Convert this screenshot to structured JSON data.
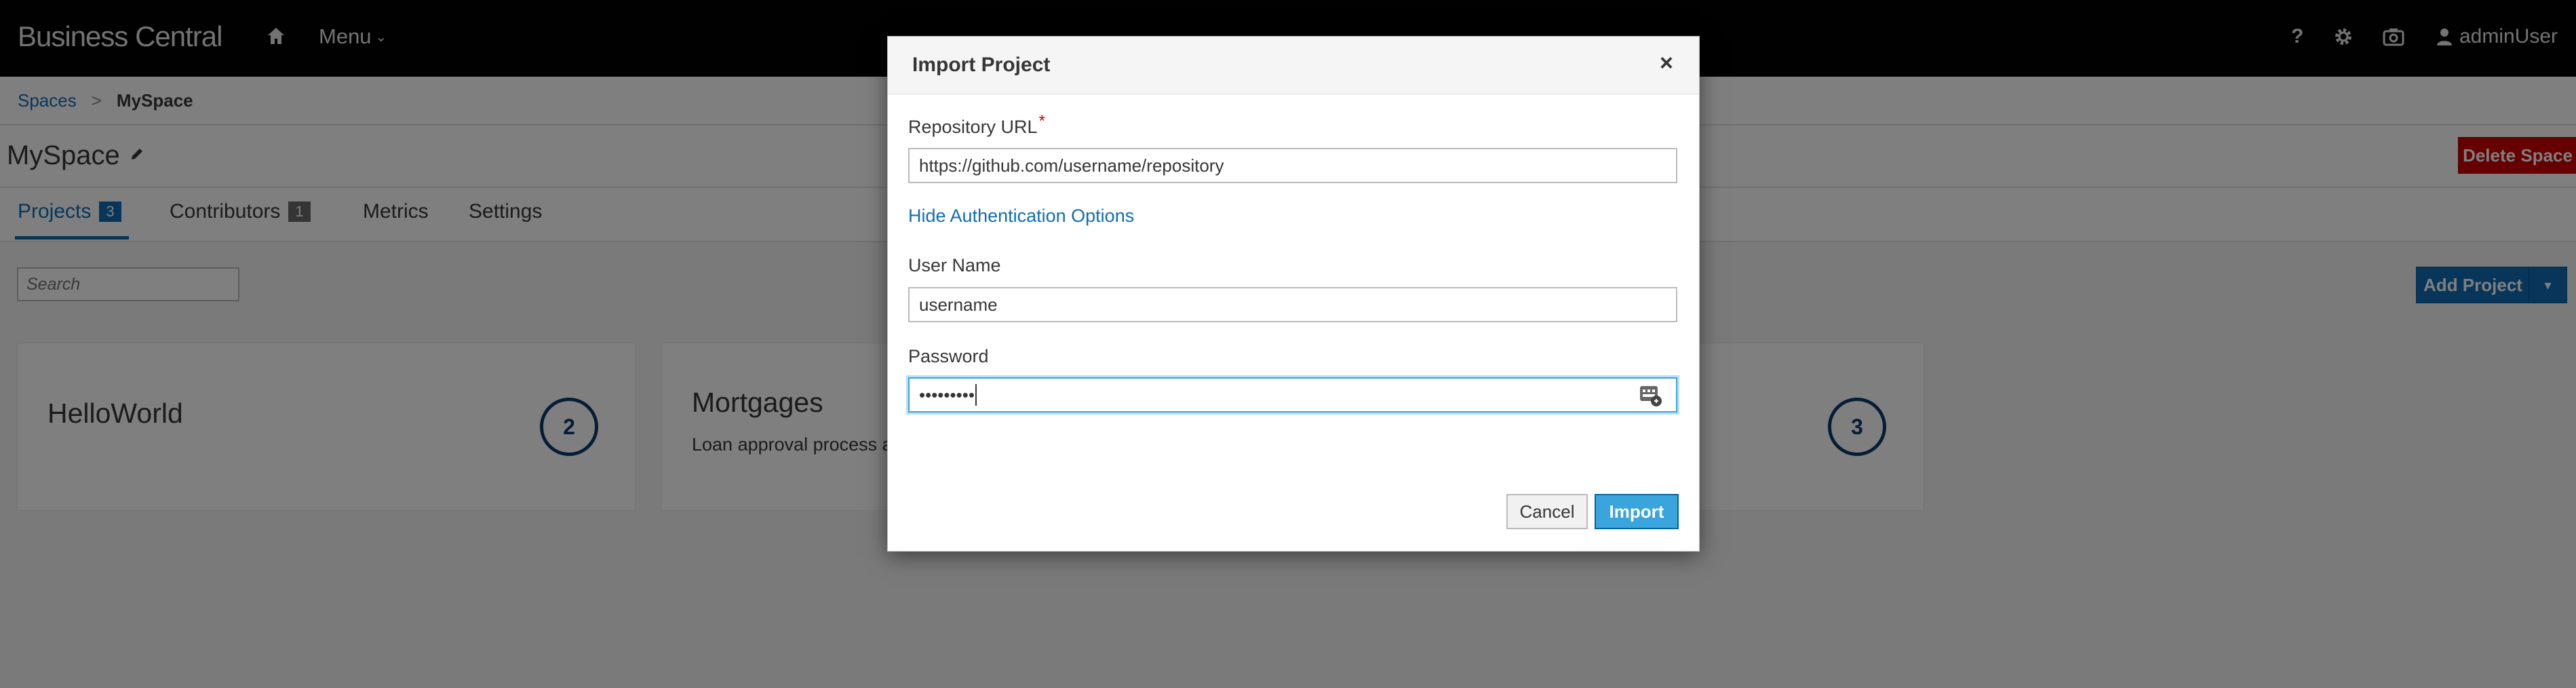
{
  "navbar": {
    "brand": "Business Central",
    "menu_label": "Menu",
    "help_label": "?",
    "user_label": "adminUser"
  },
  "breadcrumb": {
    "root": "Spaces",
    "separator": ">",
    "current": "MySpace"
  },
  "space": {
    "title": "MySpace",
    "delete_label": "Delete Space"
  },
  "tabs": [
    {
      "label": "Projects",
      "badge": "3"
    },
    {
      "label": "Contributors",
      "badge": "1"
    },
    {
      "label": "Metrics"
    },
    {
      "label": "Settings"
    }
  ],
  "toolbar": {
    "search_placeholder": "Search",
    "add_project_label": "Add Project"
  },
  "projects": [
    {
      "name": "HelloWorld",
      "description": "",
      "count": "2"
    },
    {
      "name": "Mortgages",
      "description": "Loan approval process a",
      "count": ""
    },
    {
      "name": "",
      "description": "",
      "count": "3"
    }
  ],
  "modal": {
    "title": "Import Project",
    "close_label": "×",
    "repo_url_label": "Repository URL",
    "required_mark": "*",
    "repo_url_value": "https://github.com/username/repository",
    "auth_toggle_label": "Hide Authentication Options",
    "username_label": "User Name",
    "username_value": "username",
    "password_label": "Password",
    "password_value": "•••••••••",
    "cancel_label": "Cancel",
    "import_label": "Import"
  },
  "colors": {
    "navbar": "#030303",
    "link": "#0f6db5",
    "primary": "#0f6db5",
    "import_button": "#39a5dc",
    "danger": "#cc0000",
    "count_circle": "#0a3a6b"
  }
}
